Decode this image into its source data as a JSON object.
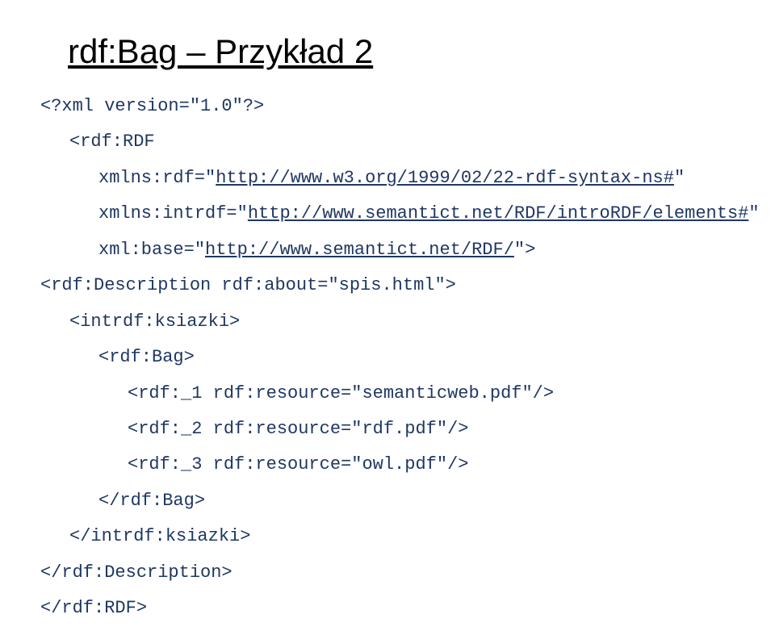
{
  "title": "rdf:Bag – Przykład 2",
  "code": {
    "lines": [
      {
        "text": "<?xml version=\"1.0\"?>",
        "indent": 0,
        "underlinedParts": []
      },
      {
        "text": "<rdf:RDF",
        "indent": 1,
        "underlinedParts": []
      },
      {
        "text": "xmlns:rdf=\"http://www.w3.org/1999/02/22-rdf-syntax-ns#\"",
        "indent": 2,
        "underlinedParts": [
          "http://www.w3.org/1999/02/22-rdf-syntax-ns#"
        ]
      },
      {
        "text": "xmlns:intrdf=\"http://www.semantict.net/RDF/introRDF/elements#\"",
        "indent": 2,
        "underlinedParts": [
          "http://www.semantict.net/RDF/introRDF/elements#"
        ]
      },
      {
        "text": "xml:base=\"http://www.semantict.net/RDF/\">",
        "indent": 2,
        "underlinedParts": [
          "http://www.semantict.net/RDF/"
        ]
      },
      {
        "text": "<rdf:Description rdf:about=\"spis.html\">",
        "indent": 0,
        "underlinedParts": []
      },
      {
        "text": "<intrdf:ksiazki>",
        "indent": 1,
        "underlinedParts": []
      },
      {
        "text": "<rdf:Bag>",
        "indent": 2,
        "underlinedParts": []
      },
      {
        "text": "<rdf:_1 rdf:resource=\"semanticweb.pdf\"/>",
        "indent": 3,
        "underlinedParts": []
      },
      {
        "text": "<rdf:_2 rdf:resource=\"rdf.pdf\"/>",
        "indent": 3,
        "underlinedParts": []
      },
      {
        "text": "<rdf:_3 rdf:resource=\"owl.pdf\"/>",
        "indent": 3,
        "underlinedParts": []
      },
      {
        "text": "</rdf:Bag>",
        "indent": 2,
        "underlinedParts": []
      },
      {
        "text": "</intrdf:ksiazki>",
        "indent": 1,
        "underlinedParts": []
      },
      {
        "text": "</rdf:Description>",
        "indent": 0,
        "underlinedParts": []
      },
      {
        "text": "</rdf:RDF>",
        "indent": 0,
        "underlinedParts": []
      }
    ]
  }
}
